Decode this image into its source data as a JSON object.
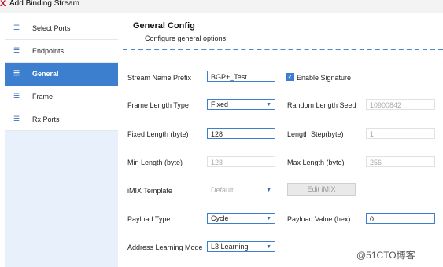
{
  "window": {
    "title": "Add Binding Stream",
    "icon": "x-icon"
  },
  "sidebar": {
    "items": [
      {
        "label": "Select Ports",
        "icon": "menu-icon",
        "active": false
      },
      {
        "label": "Endpoints",
        "icon": "menu-icon",
        "active": false
      },
      {
        "label": "General",
        "icon": "menu-icon",
        "active": true
      },
      {
        "label": "Frame",
        "icon": "menu-icon",
        "active": false
      },
      {
        "label": "Rx Ports",
        "icon": "menu-icon",
        "active": false
      }
    ]
  },
  "main": {
    "title": "General Config",
    "subtitle": "Configure general options",
    "fields": {
      "stream_name_prefix": {
        "label": "Stream Name Prefix",
        "value": "BGP+_Test"
      },
      "enable_signature": {
        "label": "Enable Signature",
        "checked": true
      },
      "frame_length_type": {
        "label": "Frame Length Type",
        "value": "Fixed"
      },
      "random_length_seed": {
        "label": "Random Length Seed",
        "value": "10900842"
      },
      "fixed_length": {
        "label": "Fixed Length (byte)",
        "value": "128"
      },
      "length_step": {
        "label": "Length Step(byte)",
        "value": "1"
      },
      "min_length": {
        "label": "Min Length (byte)",
        "value": "128"
      },
      "max_length": {
        "label": "Max Length (byte)",
        "value": "256"
      },
      "imix_template": {
        "label": "iMIX Template",
        "value": "Default"
      },
      "edit_imix": {
        "label": "Edit iMIX"
      },
      "payload_type": {
        "label": "Payload Type",
        "value": "Cycle"
      },
      "payload_value": {
        "label": "Payload Value (hex)",
        "value": "0"
      },
      "address_learning_mode": {
        "label": "Address Learning Mode",
        "value": "L3 Learning"
      }
    }
  },
  "watermark": "@51CTO博客",
  "colors": {
    "accent": "#3d7fcf",
    "sidebar_bg": "#e8f1fb",
    "brand_icon": "#c0142f"
  }
}
